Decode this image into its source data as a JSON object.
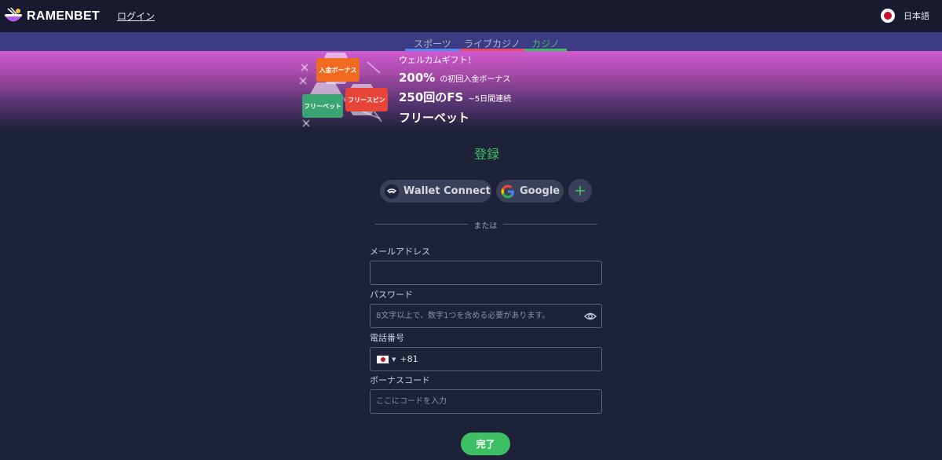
{
  "header": {
    "logo_text": "RAMENBET",
    "login_label": "ログイン",
    "language_label": "日本語"
  },
  "tabs": [
    {
      "label": "スポーツ",
      "color": "#4b8ff0"
    },
    {
      "label": "ライブカジノ",
      "color": "#e84a6a"
    },
    {
      "label": "カジノ",
      "color": "#3fbf63",
      "active": true
    }
  ],
  "banner": {
    "badges": [
      "入金ボーナス",
      "フリーベット",
      "フリースピン"
    ],
    "line1": "ウェルカムギフト！",
    "line2_big": "200%",
    "line2_small": "の初回入金ボーナス",
    "line3_big": "250回のFS",
    "line3_small": "~5日間連続",
    "line4_big": "フリーベット"
  },
  "registration": {
    "title": "登録",
    "wallet_connect_label": "Wallet Connect",
    "google_label": "Google",
    "or_label": "または",
    "email_label": "メールアドレス",
    "email_value": "",
    "password_label": "パスワード",
    "password_placeholder": "8文字以上で、数字1つを含める必要があります。",
    "phone_label": "電話番号",
    "phone_dial_code": "+81",
    "bonus_label": "ボーナスコード",
    "bonus_placeholder": "ここにコードを入力",
    "submit_label": "完了"
  },
  "colors": {
    "accent_green": "#3fbf63",
    "background": "#1e2238",
    "topbar": "#181b30",
    "tab_strip": "#3d3b84"
  },
  "icons": [
    "ramen-bowl-logo-icon",
    "japan-flag-icon",
    "wallet-connect-icon",
    "google-icon",
    "plus-icon",
    "eye-icon",
    "chevron-down-icon"
  ]
}
